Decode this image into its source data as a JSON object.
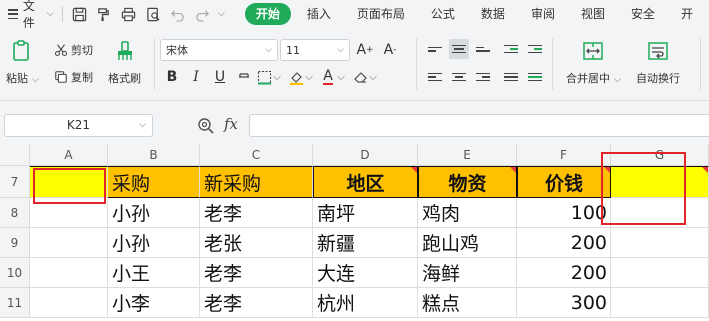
{
  "menu": {
    "file_label": "文件",
    "tabs": [
      {
        "label": "开始",
        "active": true
      },
      {
        "label": "插入"
      },
      {
        "label": "页面布局"
      },
      {
        "label": "公式"
      },
      {
        "label": "数据"
      },
      {
        "label": "审阅"
      },
      {
        "label": "视图"
      },
      {
        "label": "安全"
      },
      {
        "label": "开"
      }
    ]
  },
  "ribbon": {
    "paste": "粘贴",
    "cut": "剪切",
    "copy": "复制",
    "format_painter": "格式刷",
    "font_name": "宋体",
    "font_size": "11",
    "merge_center": "合并居中",
    "wrap_text": "自动换行"
  },
  "formula_bar": {
    "cell_ref": "K21",
    "fx": "fx",
    "formula": ""
  },
  "sheet": {
    "columns": [
      "A",
      "B",
      "C",
      "D",
      "E",
      "F",
      "G"
    ],
    "rows": [
      {
        "num": "7",
        "cells": [
          "",
          "采购",
          "新采购",
          "地区",
          "物资",
          "价钱",
          ""
        ]
      },
      {
        "num": "8",
        "cells": [
          "",
          "小孙",
          "老李",
          "南坪",
          "鸡肉",
          "100",
          ""
        ]
      },
      {
        "num": "9",
        "cells": [
          "",
          "小孙",
          "老张",
          "新疆",
          "跑山鸡",
          "200",
          ""
        ]
      },
      {
        "num": "10",
        "cells": [
          "",
          "小王",
          "老李",
          "大连",
          "海鲜",
          "200",
          ""
        ]
      },
      {
        "num": "11",
        "cells": [
          "",
          "小李",
          "老李",
          "杭州",
          "糕点",
          "300",
          ""
        ]
      }
    ]
  },
  "colors": {
    "accent": "#1fab5a",
    "header_fill": "#ffc000",
    "highlight_fill": "#ffff00",
    "annotation_red": "#e0242a"
  },
  "icons": [
    "menu-icon",
    "save-icon",
    "format-painter-icon",
    "print-icon",
    "print-preview-icon",
    "undo-icon",
    "redo-icon",
    "zoom-icon"
  ]
}
